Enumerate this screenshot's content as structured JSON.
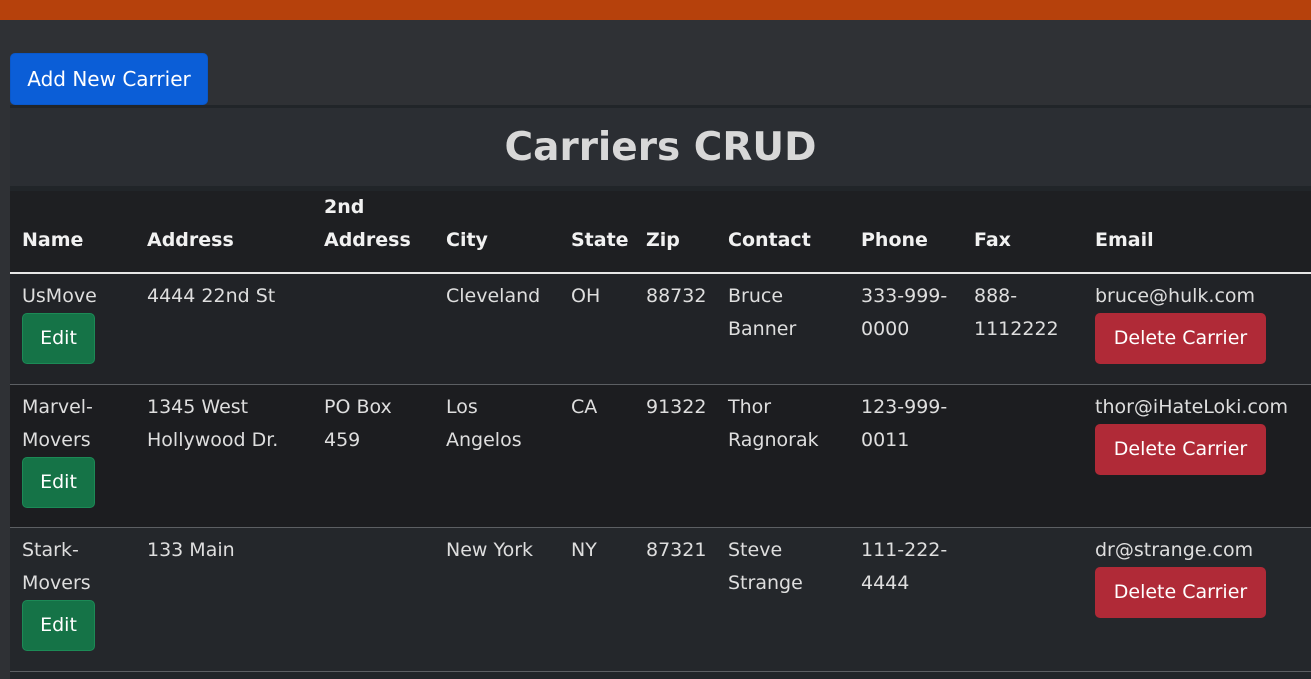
{
  "add_button_label": "Add New Carrier",
  "page_title": "Carriers CRUD",
  "columns": [
    "Name",
    "Address",
    "2nd Address",
    "City",
    "State",
    "Zip",
    "Contact",
    "Phone",
    "Fax",
    "Email"
  ],
  "rows": [
    {
      "name": "UsMove",
      "address": "4444 22nd St",
      "address2": "",
      "city": "Cleveland",
      "state": "OH",
      "zip": "88732",
      "contact": "Bruce Banner",
      "phone": "333-999-0000",
      "fax": "888-1112222",
      "email": "bruce@hulk.com"
    },
    {
      "name": "Marvel-Movers",
      "address": "1345 West Hollywood Dr.",
      "address2": "PO Box 459",
      "city": "Los Angelos",
      "state": "CA",
      "zip": "91322",
      "contact": "Thor Ragnorak",
      "phone": "123-999-0011",
      "fax": "",
      "email": "thor@iHateLoki.com"
    },
    {
      "name": "Stark-Movers",
      "address": "133 Main",
      "address2": "",
      "city": "New York",
      "state": "NY",
      "zip": "87321",
      "contact": "Steve Strange",
      "phone": "111-222-4444",
      "fax": "",
      "email": "dr@strange.com"
    }
  ],
  "edit_label": "Edit",
  "delete_label": "Delete Carrier",
  "colors": {
    "top_bar": "#b6410c",
    "primary": "#0b5ed7",
    "success": "#157347",
    "danger": "#b02a37",
    "table_bg": "#212529"
  }
}
